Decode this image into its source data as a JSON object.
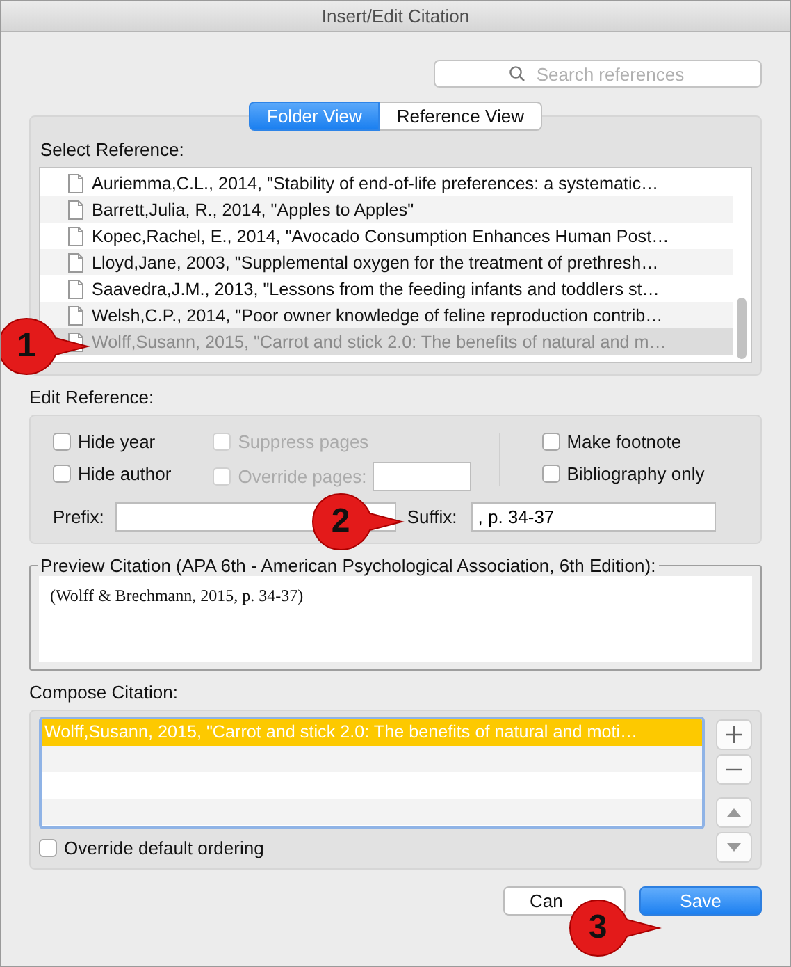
{
  "window": {
    "title": "Insert/Edit Citation"
  },
  "search": {
    "placeholder": "Search references"
  },
  "tabs": [
    {
      "label": "Folder View",
      "selected": true
    },
    {
      "label": "Reference View",
      "selected": false
    }
  ],
  "select_reference": {
    "label": "Select Reference:",
    "rows": [
      {
        "text": "Auriemma,C.L., 2014, \"Stability of end-of-life preferences: a systematic…",
        "selected": false
      },
      {
        "text": "Barrett,Julia, R., 2014, \"Apples to Apples\"",
        "selected": false
      },
      {
        "text": "Kopec,Rachel, E., 2014, \"Avocado Consumption Enhances Human Post…",
        "selected": false
      },
      {
        "text": "Lloyd,Jane, 2003, \"Supplemental oxygen for the treatment of prethresh…",
        "selected": false
      },
      {
        "text": "Saavedra,J.M., 2013, \"Lessons from the feeding infants and toddlers st…",
        "selected": false
      },
      {
        "text": "Welsh,C.P., 2014, \"Poor owner knowledge of feline reproduction contrib…",
        "selected": false
      },
      {
        "text": "Wolff,Susann, 2015, \"Carrot and stick 2.0: The benefits of natural and m…",
        "selected": true
      }
    ]
  },
  "edit_reference": {
    "label": "Edit Reference:",
    "options": [
      {
        "label": "Hide year",
        "checked": false,
        "disabled": false
      },
      {
        "label": "Hide author",
        "checked": false,
        "disabled": false
      },
      {
        "label": "Suppress pages",
        "checked": false,
        "disabled": true
      },
      {
        "label": "Override pages:",
        "checked": false,
        "disabled": true
      },
      {
        "label": "Make footnote",
        "checked": false,
        "disabled": false
      },
      {
        "label": "Bibliography only",
        "checked": false,
        "disabled": false
      }
    ],
    "prefix_label": "Prefix:",
    "suffix_label": "Suffix:",
    "suffix_value": ", p. 34-37"
  },
  "preview": {
    "label": "Preview Citation (APA 6th - American Psychological Association, 6th Edition):",
    "text": "(Wolff & Brechmann, 2015, p. 34-37)"
  },
  "compose": {
    "label": "Compose Citation:",
    "rows": [
      {
        "text": "Wolff,Susann, 2015, \"Carrot and stick 2.0: The benefits of natural and moti…",
        "selected": true
      }
    ],
    "override": {
      "label": "Override default ordering",
      "checked": false
    }
  },
  "buttons": [
    {
      "label": "Can",
      "kind": "cancel"
    },
    {
      "label": "Save",
      "kind": "default"
    }
  ],
  "callouts": [
    {
      "number": "1"
    },
    {
      "number": "2"
    },
    {
      "number": "3"
    }
  ]
}
